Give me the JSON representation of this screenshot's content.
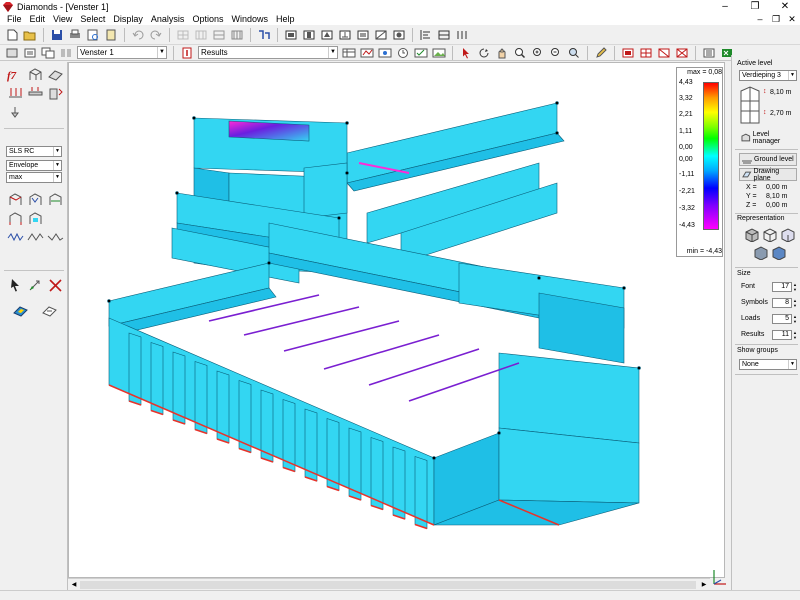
{
  "window": {
    "title": "Diamonds - [Venster 1]",
    "controls": [
      "–",
      "❐",
      "✕"
    ],
    "mdi_controls": [
      "–",
      "❐",
      "✕"
    ]
  },
  "menu": [
    "File",
    "Edit",
    "View",
    "Select",
    "Display",
    "Analysis",
    "Options",
    "Windows",
    "Help"
  ],
  "toolbar2": {
    "window_combo": "Venster 1",
    "results_combo": "Results"
  },
  "left_panel": {
    "limit_state": "SLS RC",
    "envelope": "Envelope",
    "extreme": "max"
  },
  "legend": {
    "max_label": "max = 0,08",
    "min_label": "min = -4,43",
    "ticks": [
      "4,43",
      "3,32",
      "2,21",
      "1,11",
      "0,00",
      "0,00",
      "-1,11",
      "-2,21",
      "-3,32",
      "-4,43"
    ],
    "colors": {
      "top": "#ff0000",
      "mid": "#00ffff",
      "bottom": "#ff00ff"
    }
  },
  "right_panel": {
    "active_level_title": "Active level",
    "active_level": "Verdieping 3",
    "level_top": "8,10 m",
    "level_bottom": "2,70 m",
    "level_manager": "Level manager",
    "ground_level": "Ground level",
    "drawing_plane": "Drawing plane",
    "coords": {
      "x_label": "X =",
      "x": "0,00 m",
      "y_label": "Y =",
      "y": "8,10 m",
      "z_label": "Z =",
      "z": "0,00 m"
    },
    "representation_title": "Representation",
    "size_title": "Size",
    "size": {
      "font_label": "Font",
      "font": "17",
      "symbols_label": "Symbols",
      "symbols": "8",
      "loads_label": "Loads",
      "loads": "5",
      "results_label": "Results",
      "results": "11"
    },
    "show_groups_title": "Show groups",
    "show_groups": "None"
  },
  "model_colors": {
    "fill": "#33d6f2",
    "fill_dark": "#1fbfe6",
    "edge": "#0a5f7a",
    "support": "#e8332a",
    "stress": "#7a1fd1",
    "hot": "#ff2bd8"
  }
}
